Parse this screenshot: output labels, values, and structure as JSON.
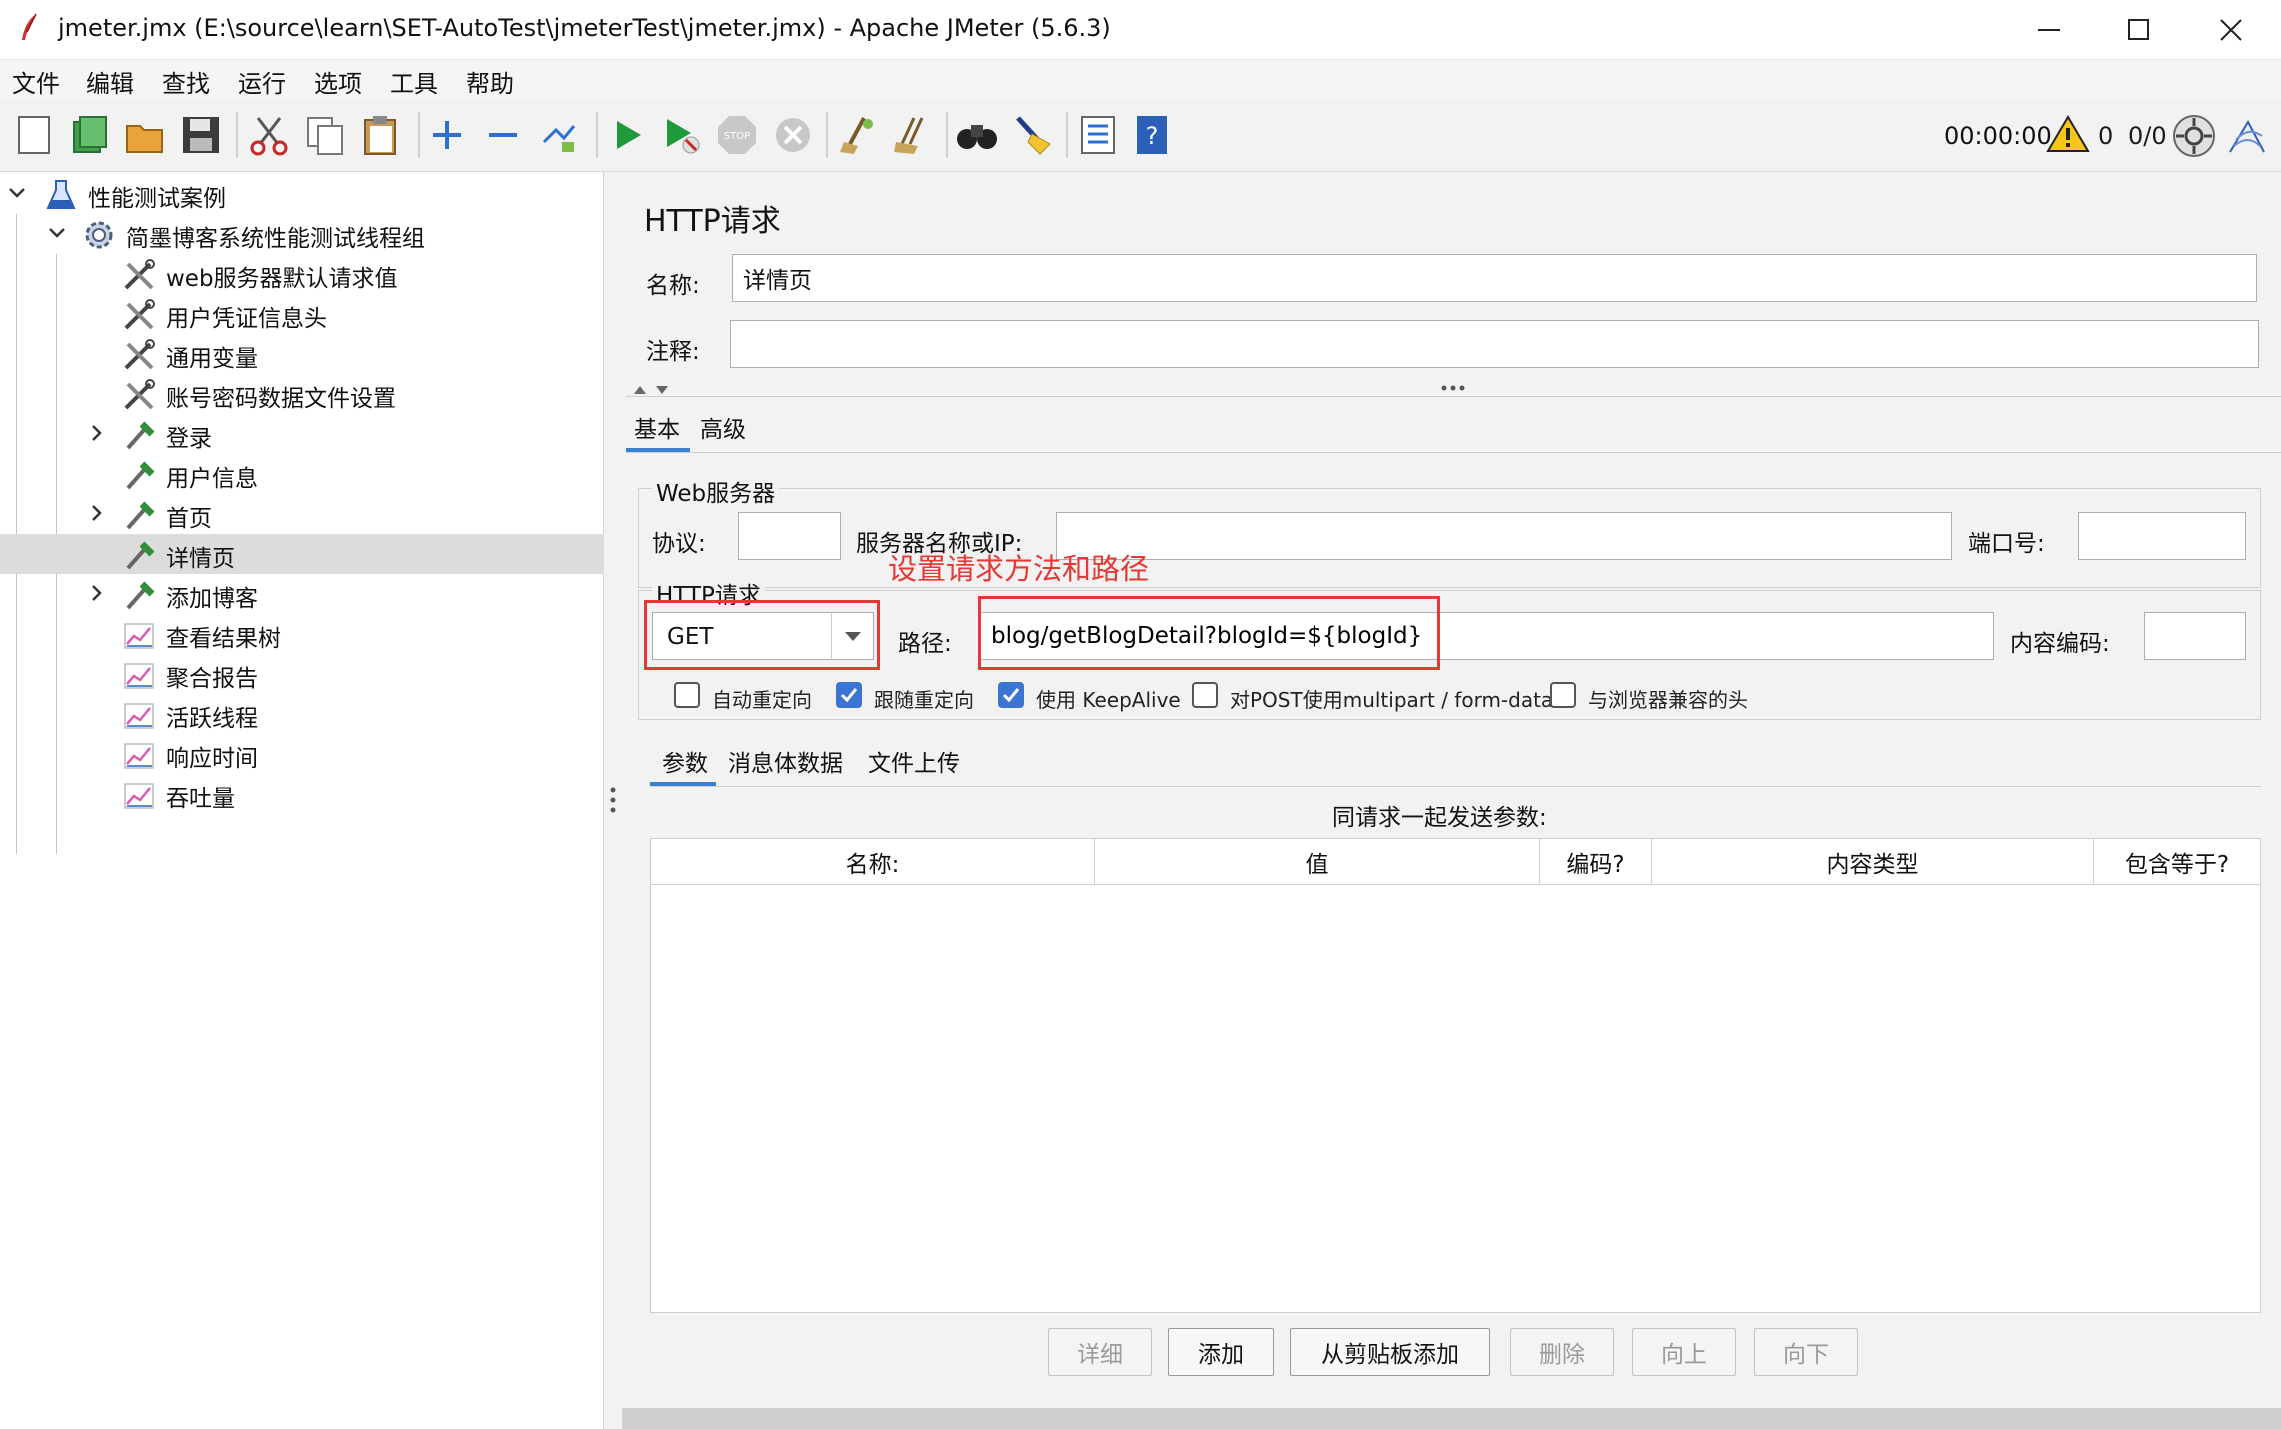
{
  "window": {
    "title": "jmeter.jmx (E:\\source\\learn\\SET-AutoTest\\jmeterTest\\jmeter.jmx) - Apache JMeter (5.6.3)",
    "minimize": "—",
    "maximize": "☐",
    "close": "✕"
  },
  "menu": [
    "文件",
    "编辑",
    "查找",
    "运行",
    "选项",
    "工具",
    "帮助"
  ],
  "toolbar": {
    "timer": "00:00:00",
    "warning_count": "0",
    "threads": "0/0",
    "icons": [
      "new-icon",
      "templates-icon",
      "open-icon",
      "save-icon",
      "cut-icon",
      "copy-icon",
      "paste-icon",
      "expand-icon",
      "collapse-icon",
      "toggle-icon",
      "start-icon",
      "start-no-pause-icon",
      "stop-icon",
      "shutdown-icon",
      "clear-icon",
      "clear-all-icon",
      "search-icon",
      "reset-search-icon",
      "function-helper-icon",
      "help-icon"
    ]
  },
  "tree": {
    "root": "性能测试案例",
    "thread_group": "简墨博客系统性能测试线程组",
    "children": [
      {
        "label": "web服务器默认请求值",
        "type": "config"
      },
      {
        "label": "用户凭证信息头",
        "type": "config"
      },
      {
        "label": "通用变量",
        "type": "config"
      },
      {
        "label": "账号密码数据文件设置",
        "type": "config"
      },
      {
        "label": "登录",
        "type": "sampler",
        "expandable": true
      },
      {
        "label": "用户信息",
        "type": "sampler"
      },
      {
        "label": "首页",
        "type": "sampler",
        "expandable": true
      },
      {
        "label": "详情页",
        "type": "sampler",
        "selected": true
      },
      {
        "label": "添加博客",
        "type": "sampler",
        "expandable": true
      },
      {
        "label": "查看结果树",
        "type": "listener"
      },
      {
        "label": "聚合报告",
        "type": "listener"
      },
      {
        "label": "活跃线程",
        "type": "listener"
      },
      {
        "label": "响应时间",
        "type": "listener"
      },
      {
        "label": "吞吐量",
        "type": "listener"
      }
    ]
  },
  "panel": {
    "heading": "HTTP请求",
    "name_label": "名称:",
    "name_value": "详情页",
    "comment_label": "注释:",
    "comment_value": "",
    "tabs": [
      "基本",
      "高级"
    ],
    "web_server": {
      "title": "Web服务器",
      "protocol_label": "协议:",
      "protocol_value": "",
      "server_label": "服务器名称或IP:",
      "server_value": "",
      "port_label": "端口号:",
      "port_value": ""
    },
    "http_request": {
      "title": "HTTP请求",
      "method": "GET",
      "path_label": "路径:",
      "path_value": "blog/getBlogDetail?blogId=${blogId}",
      "encoding_label": "内容编码:",
      "encoding_value": ""
    },
    "checkboxes": [
      {
        "label": "自动重定向",
        "checked": false
      },
      {
        "label": "跟随重定向",
        "checked": true
      },
      {
        "label": "使用 KeepAlive",
        "checked": true
      },
      {
        "label": "对POST使用multipart / form-data",
        "checked": false
      },
      {
        "label": "与浏览器兼容的头",
        "checked": false
      }
    ],
    "sub_tabs": [
      "参数",
      "消息体数据",
      "文件上传"
    ],
    "params_caption": "同请求一起发送参数:",
    "table_headers": [
      "名称:",
      "值",
      "编码?",
      "内容类型",
      "包含等于?"
    ],
    "buttons": [
      {
        "label": "详细",
        "enabled": false
      },
      {
        "label": "添加",
        "enabled": true
      },
      {
        "label": "从剪贴板添加",
        "enabled": true
      },
      {
        "label": "删除",
        "enabled": false
      },
      {
        "label": "向上",
        "enabled": false
      },
      {
        "label": "向下",
        "enabled": false
      }
    ]
  },
  "annotation": "设置请求方法和路径",
  "colors": {
    "annotation": "#e53935",
    "tab_accent": "#3b7fd1",
    "checkbox_on": "#3b74d1"
  }
}
